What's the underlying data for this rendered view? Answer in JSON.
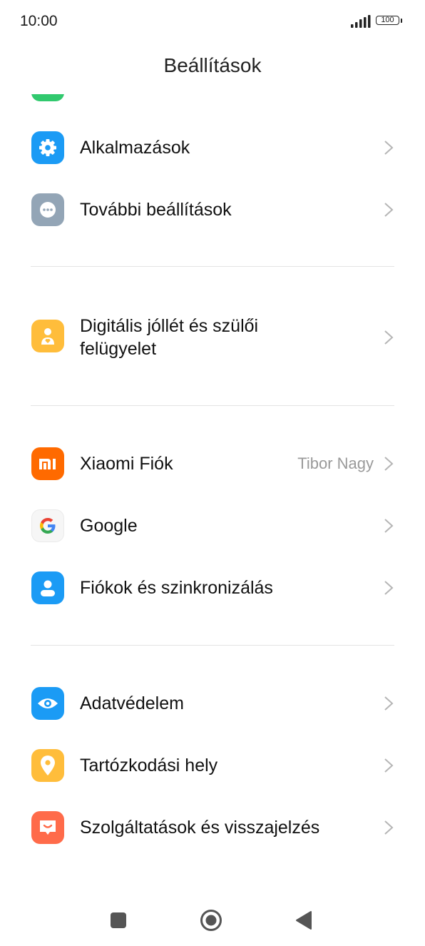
{
  "status": {
    "time": "10:00",
    "battery": "100"
  },
  "header": {
    "title": "Beállítások"
  },
  "items": [
    {
      "label": "Alkalmazások",
      "icon": "gear-icon",
      "color": "#1b9bf5"
    },
    {
      "label": "További beállítások",
      "icon": "more-dots-icon",
      "color": "#93a5b6"
    },
    {
      "label_line1": "Digitális jóllét és szülői",
      "label_line2": "felügyelet",
      "icon": "wellbeing-icon",
      "color": "#ffbd3b"
    },
    {
      "label": "Xiaomi Fiók",
      "value": "Tibor Nagy",
      "icon": "mi-logo-icon",
      "color": "#ff6a00"
    },
    {
      "label": "Google",
      "icon": "google-icon",
      "color": "#f4f4f4"
    },
    {
      "label": "Fiókok és szinkronizálás",
      "icon": "account-icon",
      "color": "#1b9bf5"
    },
    {
      "label": "Adatvédelem",
      "icon": "eye-icon",
      "color": "#1b9bf5"
    },
    {
      "label": "Tartózkodási hely",
      "icon": "location-pin-icon",
      "color": "#ffbd3b"
    },
    {
      "label": "Szolgáltatások és visszajelzés",
      "icon": "feedback-icon",
      "color": "#ff6b4a"
    }
  ]
}
